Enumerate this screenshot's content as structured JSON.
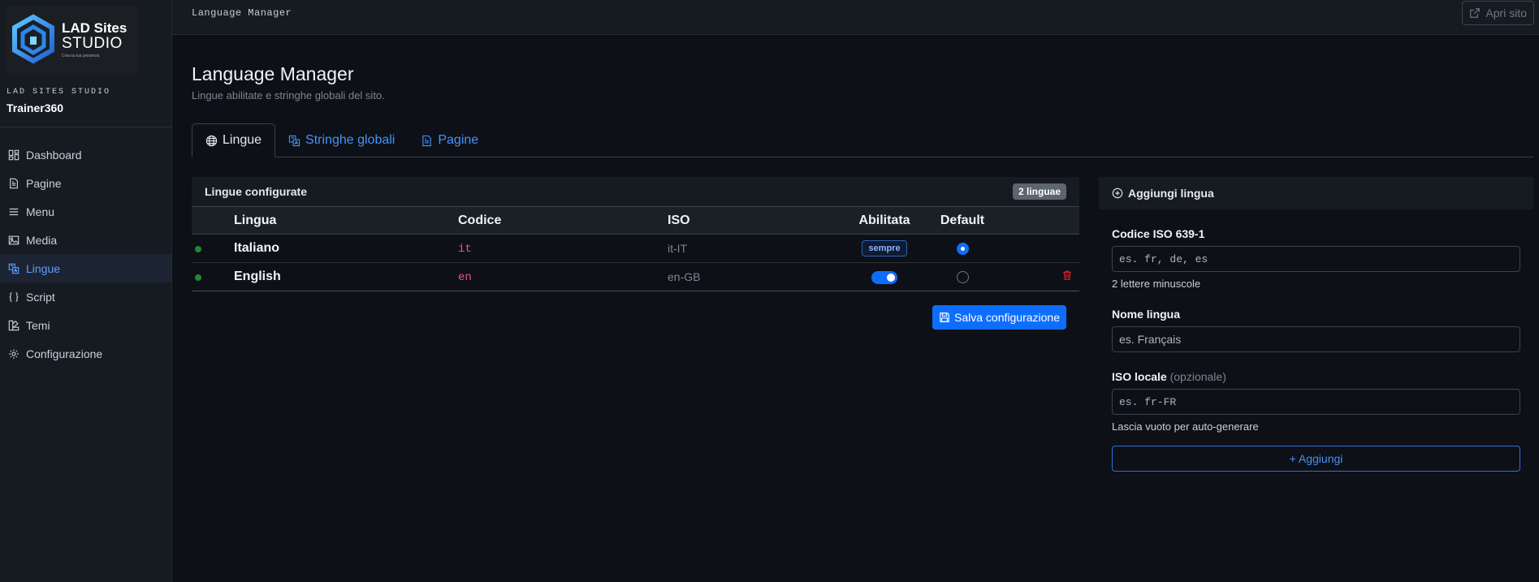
{
  "brand": {
    "logo_line1": "LAD Sites",
    "logo_line2": "STUDIO",
    "logo_line3": "Crea la tua presenza",
    "studio_label": "LAD SITES STUDIO",
    "site_name": "Trainer360"
  },
  "sidebar": {
    "items": [
      {
        "label": "Dashboard",
        "icon": "dashboard-icon"
      },
      {
        "label": "Pagine",
        "icon": "file-icon"
      },
      {
        "label": "Menu",
        "icon": "menu-icon"
      },
      {
        "label": "Media",
        "icon": "image-icon"
      },
      {
        "label": "Lingue",
        "icon": "translate-icon",
        "active": true
      },
      {
        "label": "Script",
        "icon": "braces-icon"
      },
      {
        "label": "Temi",
        "icon": "palette-icon"
      },
      {
        "label": "Configurazione",
        "icon": "gear-icon"
      }
    ]
  },
  "topbar": {
    "title": "Language Manager",
    "open_site_label": "Apri sito"
  },
  "header": {
    "title": "Language Manager",
    "subtitle": "Lingue abilitate e stringhe globali del sito."
  },
  "tabs": [
    {
      "label": "Lingue",
      "icon": "globe-icon",
      "active": true
    },
    {
      "label": "Stringhe globali",
      "icon": "translate-icon"
    },
    {
      "label": "Pagine",
      "icon": "file-icon"
    }
  ],
  "languages_card": {
    "title": "Lingue configurate",
    "count_badge": "2 linguae",
    "columns": [
      "Lingua",
      "Codice",
      "ISO",
      "Abilitata",
      "Default"
    ],
    "rows": [
      {
        "name": "Italiano",
        "code": "it",
        "iso": "it-IT",
        "enabled_label": "sempre",
        "enabled": true,
        "default": true,
        "deletable": false
      },
      {
        "name": "English",
        "code": "en",
        "iso": "en-GB",
        "enabled": true,
        "default": false,
        "deletable": true
      }
    ],
    "save_label": "Salva configurazione"
  },
  "add_card": {
    "title": "Aggiungi lingua",
    "code_label": "Codice ISO 639-1",
    "code_placeholder": "es. fr, de, es",
    "code_help": "2 lettere minuscole",
    "name_label": "Nome lingua",
    "name_placeholder": "es. Français",
    "locale_label": "ISO locale",
    "locale_optional": "(opzionale)",
    "locale_placeholder": "es. fr-FR",
    "locale_help": "Lascia vuoto per auto-generare",
    "add_button": "+  Aggiungi"
  },
  "colors": {
    "accent": "#0d6efd",
    "link": "#4493f8",
    "status_dot": "#238636",
    "danger": "#d1242f"
  }
}
